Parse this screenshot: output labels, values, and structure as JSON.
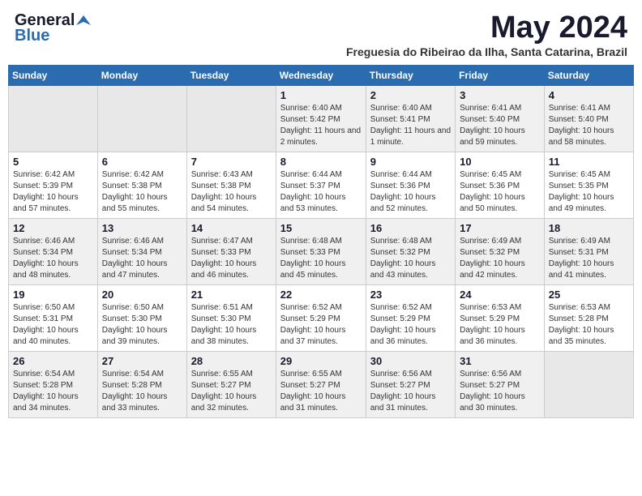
{
  "logo": {
    "line1": "General",
    "line2": "Blue"
  },
  "title": {
    "month_year": "May 2024",
    "location": "Freguesia do Ribeirao da Ilha, Santa Catarina, Brazil"
  },
  "weekdays": [
    "Sunday",
    "Monday",
    "Tuesday",
    "Wednesday",
    "Thursday",
    "Friday",
    "Saturday"
  ],
  "weeks": [
    [
      {
        "day": "",
        "info": ""
      },
      {
        "day": "",
        "info": ""
      },
      {
        "day": "",
        "info": ""
      },
      {
        "day": "1",
        "info": "Sunrise: 6:40 AM\nSunset: 5:42 PM\nDaylight: 11 hours and 2 minutes."
      },
      {
        "day": "2",
        "info": "Sunrise: 6:40 AM\nSunset: 5:41 PM\nDaylight: 11 hours and 1 minute."
      },
      {
        "day": "3",
        "info": "Sunrise: 6:41 AM\nSunset: 5:40 PM\nDaylight: 10 hours and 59 minutes."
      },
      {
        "day": "4",
        "info": "Sunrise: 6:41 AM\nSunset: 5:40 PM\nDaylight: 10 hours and 58 minutes."
      }
    ],
    [
      {
        "day": "5",
        "info": "Sunrise: 6:42 AM\nSunset: 5:39 PM\nDaylight: 10 hours and 57 minutes."
      },
      {
        "day": "6",
        "info": "Sunrise: 6:42 AM\nSunset: 5:38 PM\nDaylight: 10 hours and 55 minutes."
      },
      {
        "day": "7",
        "info": "Sunrise: 6:43 AM\nSunset: 5:38 PM\nDaylight: 10 hours and 54 minutes."
      },
      {
        "day": "8",
        "info": "Sunrise: 6:44 AM\nSunset: 5:37 PM\nDaylight: 10 hours and 53 minutes."
      },
      {
        "day": "9",
        "info": "Sunrise: 6:44 AM\nSunset: 5:36 PM\nDaylight: 10 hours and 52 minutes."
      },
      {
        "day": "10",
        "info": "Sunrise: 6:45 AM\nSunset: 5:36 PM\nDaylight: 10 hours and 50 minutes."
      },
      {
        "day": "11",
        "info": "Sunrise: 6:45 AM\nSunset: 5:35 PM\nDaylight: 10 hours and 49 minutes."
      }
    ],
    [
      {
        "day": "12",
        "info": "Sunrise: 6:46 AM\nSunset: 5:34 PM\nDaylight: 10 hours and 48 minutes."
      },
      {
        "day": "13",
        "info": "Sunrise: 6:46 AM\nSunset: 5:34 PM\nDaylight: 10 hours and 47 minutes."
      },
      {
        "day": "14",
        "info": "Sunrise: 6:47 AM\nSunset: 5:33 PM\nDaylight: 10 hours and 46 minutes."
      },
      {
        "day": "15",
        "info": "Sunrise: 6:48 AM\nSunset: 5:33 PM\nDaylight: 10 hours and 45 minutes."
      },
      {
        "day": "16",
        "info": "Sunrise: 6:48 AM\nSunset: 5:32 PM\nDaylight: 10 hours and 43 minutes."
      },
      {
        "day": "17",
        "info": "Sunrise: 6:49 AM\nSunset: 5:32 PM\nDaylight: 10 hours and 42 minutes."
      },
      {
        "day": "18",
        "info": "Sunrise: 6:49 AM\nSunset: 5:31 PM\nDaylight: 10 hours and 41 minutes."
      }
    ],
    [
      {
        "day": "19",
        "info": "Sunrise: 6:50 AM\nSunset: 5:31 PM\nDaylight: 10 hours and 40 minutes."
      },
      {
        "day": "20",
        "info": "Sunrise: 6:50 AM\nSunset: 5:30 PM\nDaylight: 10 hours and 39 minutes."
      },
      {
        "day": "21",
        "info": "Sunrise: 6:51 AM\nSunset: 5:30 PM\nDaylight: 10 hours and 38 minutes."
      },
      {
        "day": "22",
        "info": "Sunrise: 6:52 AM\nSunset: 5:29 PM\nDaylight: 10 hours and 37 minutes."
      },
      {
        "day": "23",
        "info": "Sunrise: 6:52 AM\nSunset: 5:29 PM\nDaylight: 10 hours and 36 minutes."
      },
      {
        "day": "24",
        "info": "Sunrise: 6:53 AM\nSunset: 5:29 PM\nDaylight: 10 hours and 36 minutes."
      },
      {
        "day": "25",
        "info": "Sunrise: 6:53 AM\nSunset: 5:28 PM\nDaylight: 10 hours and 35 minutes."
      }
    ],
    [
      {
        "day": "26",
        "info": "Sunrise: 6:54 AM\nSunset: 5:28 PM\nDaylight: 10 hours and 34 minutes."
      },
      {
        "day": "27",
        "info": "Sunrise: 6:54 AM\nSunset: 5:28 PM\nDaylight: 10 hours and 33 minutes."
      },
      {
        "day": "28",
        "info": "Sunrise: 6:55 AM\nSunset: 5:27 PM\nDaylight: 10 hours and 32 minutes."
      },
      {
        "day": "29",
        "info": "Sunrise: 6:55 AM\nSunset: 5:27 PM\nDaylight: 10 hours and 31 minutes."
      },
      {
        "day": "30",
        "info": "Sunrise: 6:56 AM\nSunset: 5:27 PM\nDaylight: 10 hours and 31 minutes."
      },
      {
        "day": "31",
        "info": "Sunrise: 6:56 AM\nSunset: 5:27 PM\nDaylight: 10 hours and 30 minutes."
      },
      {
        "day": "",
        "info": ""
      }
    ]
  ]
}
